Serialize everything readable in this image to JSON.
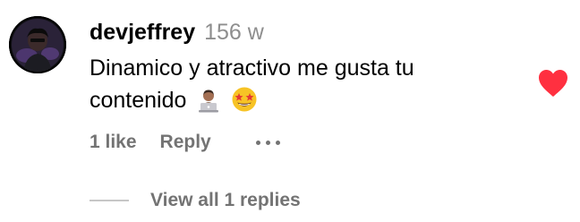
{
  "comment": {
    "username": "devjeffrey",
    "timestamp": "156 w",
    "text": "Dinamico y atractivo me gusta tu contenido",
    "emojis": [
      "technologist-emoji",
      "star-struck-emoji"
    ],
    "liked": true,
    "like_color": "#ff3040"
  },
  "actions": {
    "likes": "1 like",
    "reply_label": "Reply",
    "more_icon": "more-horizontal-icon"
  },
  "replies": {
    "label": "View all 1 replies"
  },
  "colors": {
    "text_primary": "#000000",
    "text_secondary": "#737373",
    "timestamp": "#8e8e8e",
    "heart": "#ff3040",
    "divider": "#c7c7c7"
  }
}
